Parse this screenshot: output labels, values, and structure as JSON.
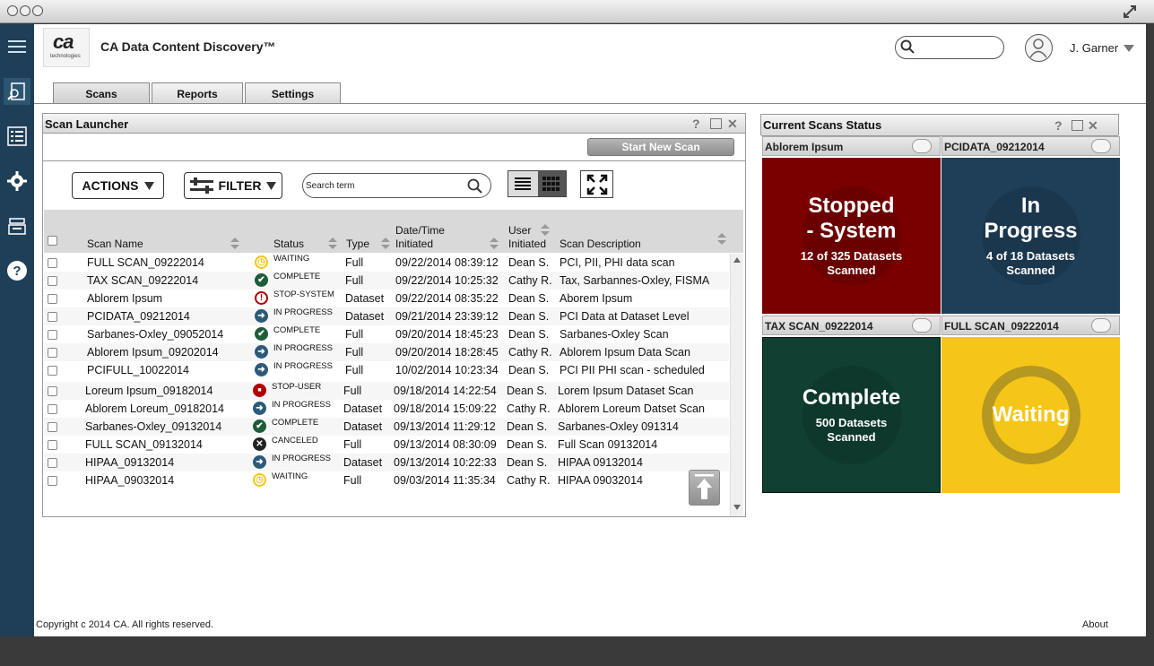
{
  "app": {
    "title": "CA Data Content Discovery™",
    "logo_text": "ca",
    "logo_sub": "technologies"
  },
  "user": {
    "name": "J. Garner"
  },
  "tabs": [
    {
      "label": "Scans"
    },
    {
      "label": "Reports"
    },
    {
      "label": "Settings"
    }
  ],
  "scan_launcher": {
    "title": "Scan Launcher",
    "start_button": "Start New Scan",
    "actions_label": "ACTIONS",
    "filter_label": "FILTER",
    "search_placeholder": "Search term",
    "columns": [
      "Scan Name",
      "Status",
      "Type",
      "Date/Time Initiated",
      "User Initiated",
      "Scan Description"
    ],
    "col_date_1": "Date/Time",
    "col_date_2": "Initiated",
    "col_user_1": "User",
    "col_user_2": "Initiated",
    "rows": [
      {
        "name": "FULL SCAN_09222014",
        "status": "WAITING",
        "type": "Full",
        "date": "09/22/2014 08:39:12",
        "user": "Dean S.",
        "desc": "PCI, PII, PHI data scan"
      },
      {
        "name": "TAX SCAN_09222014",
        "status": "COMPLETE",
        "type": "Full",
        "date": "09/22/2014 10:25:32",
        "user": "Cathy R.",
        "desc": "Tax, Sarbannes-Oxley, FISMA"
      },
      {
        "name": "Ablorem Ipsum",
        "status": "STOP-SYSTEM",
        "type": "Dataset",
        "date": "09/22/2014 08:35:22",
        "user": "Dean S.",
        "desc": "Aborem Ipsum"
      },
      {
        "name": "PCIDATA_09212014",
        "status": "IN PROGRESS",
        "type": "Dataset",
        "date": "09/21/2014 23:39:12",
        "user": "Dean S.",
        "desc": "PCI Data at Dataset Level"
      },
      {
        "name": "Sarbanes-Oxley_09052014",
        "status": "COMPLETE",
        "type": "Full",
        "date": "09/20/2014 18:45:23",
        "user": "Dean S.",
        "desc": "Sarbanes-Oxley Scan"
      },
      {
        "name": "Ablorem Ipsum_09202014",
        "status": "IN PROGRESS",
        "type": "Full",
        "date": "09/20/2014 18:28:45",
        "user": "Cathy R.",
        "desc": "Ablorem Ipsum Data Scan"
      },
      {
        "name": "PCIFULL_10022014",
        "status": "IN PROGRESS",
        "type": "Full",
        "date": "10/02/2014 10:23:34",
        "user": "Dean S.",
        "desc": "PCI PII PHI scan - scheduled"
      },
      {
        "name": "Loreum Ipsum_09182014",
        "status": "STOP-USER",
        "type": "Full",
        "date": "09/18/2014 14:22:54",
        "user": "Dean S.",
        "desc": "Lorem Ipsum Dataset Scan"
      },
      {
        "name": "Ablorem Loreum_09182014",
        "status": "IN PROGRESS",
        "type": "Dataset",
        "date": "09/18/2014 15:09:22",
        "user": "Cathy R.",
        "desc": "Ablorem Loreum Datset Scan"
      },
      {
        "name": "Sarbanes-Oxley_09132014",
        "status": "COMPLETE",
        "type": "Dataset",
        "date": "09/13/2014 11:29:12",
        "user": "Dean S.",
        "desc": "Sarbanes-Oxley 091314"
      },
      {
        "name": "FULL SCAN_09132014",
        "status": "CANCELED",
        "type": "Full",
        "date": "09/13/2014 08:30:09",
        "user": "Dean S.",
        "desc": "Full Scan 09132014"
      },
      {
        "name": "HIPAA_09132014",
        "status": "IN PROGRESS",
        "type": "Dataset",
        "date": "09/13/2014 10:22:33",
        "user": "Dean S.",
        "desc": "HIPAA 09132014"
      },
      {
        "name": "HIPAA_09032014",
        "status": "WAITING",
        "type": "Full",
        "date": "09/03/2014 11:35:34",
        "user": "Cathy R.",
        "desc": "HIPAA 09032014"
      }
    ]
  },
  "current_status": {
    "title": "Current Scans Status",
    "cards": [
      {
        "header": "Ablorem Ipsum",
        "line1": "Stopped",
        "line2": "- System",
        "detail1": "12 of 325 Datasets",
        "detail2": "Scanned",
        "color": "#7a0000"
      },
      {
        "header": "PCIDATA_09212014",
        "line1": "In",
        "line2": "Progress",
        "detail1": "4 of 18 Datasets",
        "detail2": "Scanned",
        "color": "#1f3f58"
      },
      {
        "header": "TAX SCAN_09222014",
        "line1": "Complete",
        "line2": "",
        "detail1": "500 Datasets",
        "detail2": "Scanned",
        "color": "#0f4032"
      },
      {
        "header": "FULL SCAN_09222014",
        "line1": "Waiting",
        "line2": "",
        "detail1": "",
        "detail2": "",
        "color": "#f5c518"
      }
    ]
  },
  "footer": {
    "copyright": "Copyright c 2014 CA. All rights reserved.",
    "about": "About"
  },
  "status_colors": {
    "WAITING": "#f5c518",
    "COMPLETE": "#1e5c3a",
    "STOP-SYSTEM": "#b00000",
    "IN PROGRESS": "#2c5a7a",
    "STOP-USER": "#b00000",
    "CANCELED": "#222222"
  }
}
